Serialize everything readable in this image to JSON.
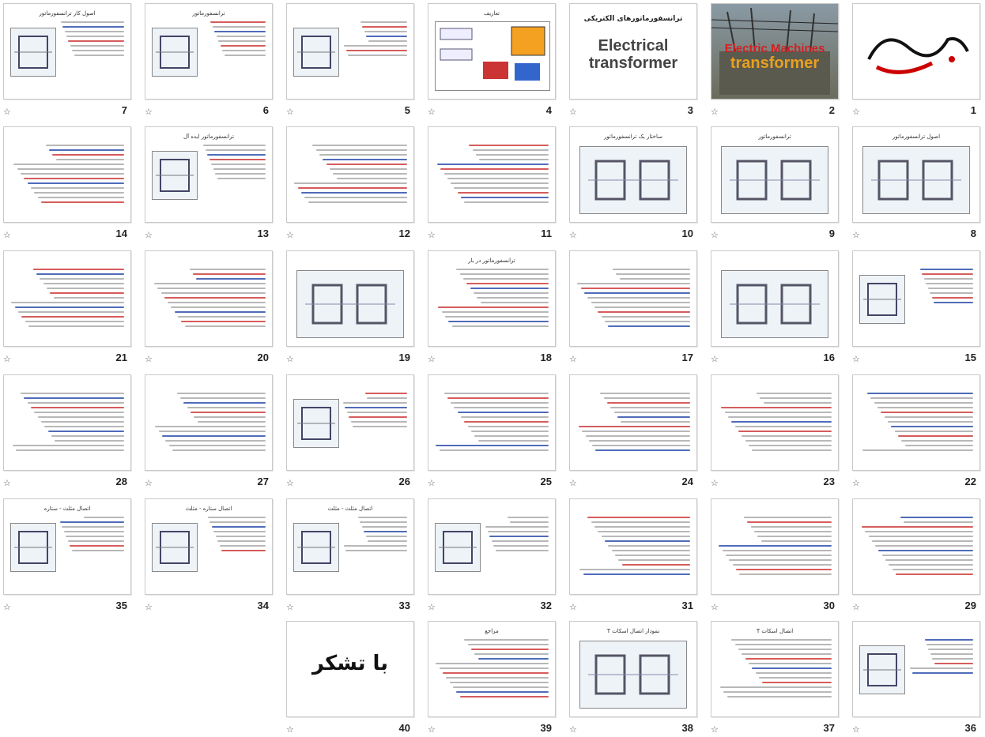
{
  "slides": [
    {
      "num": "1",
      "title": "",
      "kind": "bismillah"
    },
    {
      "num": "2",
      "title": "Electric Machines",
      "subtitle": "transformer",
      "kind": "photo"
    },
    {
      "num": "3",
      "title": "ترانسفورماتورهای الکتریکی",
      "subtitle": "Electrical transformer",
      "kind": "title"
    },
    {
      "num": "4",
      "title": "تعاریف",
      "kind": "diagram"
    },
    {
      "num": "5",
      "title": "",
      "kind": "text-fig"
    },
    {
      "num": "6",
      "title": "ترانسفورماتور",
      "kind": "text-fig"
    },
    {
      "num": "7",
      "title": "اصول کار ترانسفورماتور",
      "kind": "text-fig"
    },
    {
      "num": "8",
      "title": "اصول ترانسفورماتور",
      "kind": "fig"
    },
    {
      "num": "9",
      "title": "ترانسفورماتور",
      "kind": "fig"
    },
    {
      "num": "10",
      "title": "ساختار یک ترانسفورماتور",
      "kind": "fig"
    },
    {
      "num": "11",
      "title": "",
      "kind": "text"
    },
    {
      "num": "12",
      "title": "",
      "kind": "text"
    },
    {
      "num": "13",
      "title": "ترانسفورماتور ایده آل",
      "kind": "text-fig"
    },
    {
      "num": "14",
      "title": "",
      "kind": "text"
    },
    {
      "num": "15",
      "title": "",
      "kind": "text-fig"
    },
    {
      "num": "16",
      "title": "",
      "kind": "fig"
    },
    {
      "num": "17",
      "title": "",
      "kind": "text"
    },
    {
      "num": "18",
      "title": "ترانسفورماتور در بار",
      "kind": "text"
    },
    {
      "num": "19",
      "title": "",
      "kind": "fig"
    },
    {
      "num": "20",
      "title": "",
      "kind": "text"
    },
    {
      "num": "21",
      "title": "",
      "kind": "text"
    },
    {
      "num": "22",
      "title": "",
      "kind": "text"
    },
    {
      "num": "23",
      "title": "",
      "kind": "text"
    },
    {
      "num": "24",
      "title": "",
      "kind": "text"
    },
    {
      "num": "25",
      "title": "",
      "kind": "text"
    },
    {
      "num": "26",
      "title": "",
      "kind": "text-fig"
    },
    {
      "num": "27",
      "title": "",
      "kind": "text"
    },
    {
      "num": "28",
      "title": "",
      "kind": "text"
    },
    {
      "num": "29",
      "title": "",
      "kind": "text"
    },
    {
      "num": "30",
      "title": "",
      "kind": "text"
    },
    {
      "num": "31",
      "title": "",
      "kind": "text"
    },
    {
      "num": "32",
      "title": "",
      "kind": "text-fig"
    },
    {
      "num": "33",
      "title": "اتصال مثلث - مثلث",
      "kind": "text-fig"
    },
    {
      "num": "34",
      "title": "اتصال ستاره - مثلث",
      "kind": "text-fig"
    },
    {
      "num": "35",
      "title": "اتصال مثلث - ستاره",
      "kind": "text-fig"
    },
    {
      "num": "36",
      "title": "",
      "kind": "text-fig"
    },
    {
      "num": "37",
      "title": "اتصال اسکات T",
      "kind": "text"
    },
    {
      "num": "38",
      "title": "نمودار اتصال اسکات T",
      "kind": "fig"
    },
    {
      "num": "39",
      "title": "مراجع",
      "kind": "text"
    },
    {
      "num": "40",
      "title": "با تشکر",
      "kind": "thanks"
    }
  ]
}
